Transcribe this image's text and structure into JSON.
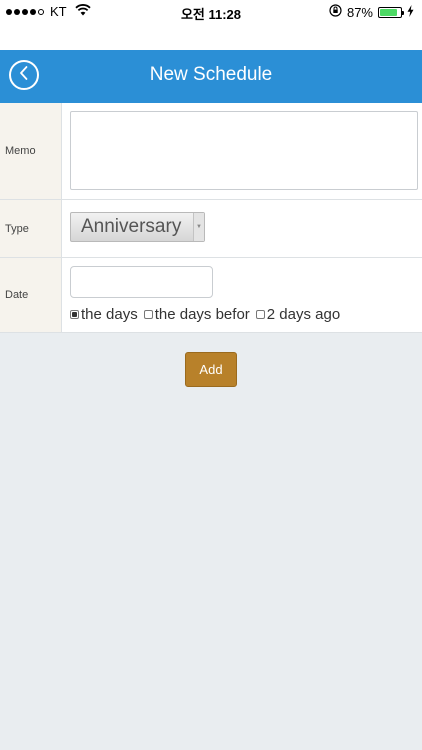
{
  "status_bar": {
    "carrier": "KT",
    "time": "오전 11:28",
    "battery_percent_label": "87%",
    "battery_level": 0.87,
    "icons": [
      "signal-dots",
      "wifi-icon",
      "orientation-lock-icon",
      "battery-icon",
      "charging-bolt-icon"
    ]
  },
  "nav": {
    "title": "New Schedule",
    "back_icon": "chevron-left-icon"
  },
  "form": {
    "memo_label": "Memo",
    "memo_value": "",
    "type_label": "Type",
    "type_value": "Anniversary",
    "date_label": "Date",
    "date_value": "",
    "date_options": [
      "the days",
      "the days befor",
      "2 days ago"
    ],
    "date_selected_index": 0
  },
  "actions": {
    "add_label": "Add"
  },
  "colors": {
    "nav_background": "#2b8fd6",
    "add_button": "#b8812a",
    "page_background": "#e9edf0",
    "label_background": "#f6f3ed"
  }
}
